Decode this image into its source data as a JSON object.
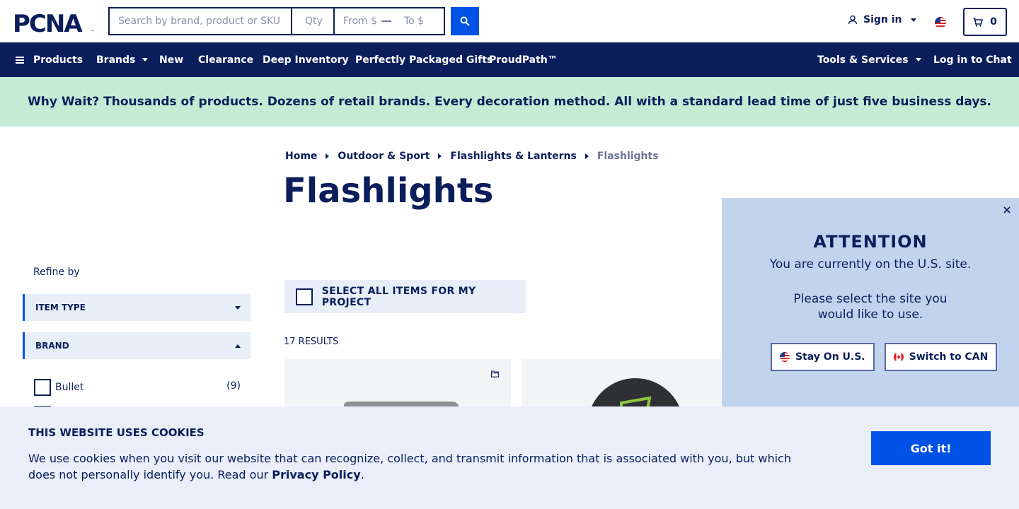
{
  "header": {
    "logo_text": "PCNA",
    "search": {
      "placeholder": "Search by brand, product or SKU",
      "value": ""
    },
    "qty": {
      "placeholder": "Qty",
      "value": ""
    },
    "price_from": {
      "placeholder": "From $",
      "value": ""
    },
    "price_to": {
      "placeholder": "To $",
      "value": ""
    },
    "signin_label": "Sign in",
    "cart_count": "0"
  },
  "nav": {
    "products": "Products",
    "brands": "Brands",
    "new": "New",
    "clearance": "Clearance",
    "deep_inventory": "Deep Inventory",
    "gifts": "Perfectly Packaged Gifts",
    "proudpath": "ProudPath™",
    "tools": "Tools & Services",
    "chat": "Log in to Chat"
  },
  "promo": "Why Wait? Thousands of products. Dozens of retail brands. Every decoration method. All with a standard lead time of just five business days.",
  "breadcrumb": [
    "Home",
    "Outdoor & Sport",
    "Flashlights & Lanterns",
    "Flashlights"
  ],
  "page_title": "Flashlights",
  "sidebar": {
    "refine_label": "Refine by",
    "facets": [
      {
        "label": "ITEM TYPE",
        "expanded": false
      },
      {
        "label": "BRAND",
        "expanded": true
      }
    ],
    "brand_options": [
      {
        "label": "Bullet",
        "count": "(9)"
      }
    ]
  },
  "select_all_label": "SELECT ALL ITEMS FOR MY PROJECT",
  "results_label": "17 RESULTS",
  "attention": {
    "title": "ATTENTION",
    "line1": "You are currently on the U.S. site.",
    "line2": "Please select the site you would like to use.",
    "stay_label": "Stay On U.S.",
    "switch_label": "Switch to CAN"
  },
  "cookie": {
    "title": "THIS WEBSITE USES COOKIES",
    "text": "We use cookies when you visit our website that can recognize, collect, and transmit information that is associated with you, but which does not personally identify you. Read our ",
    "link": "Privacy Policy",
    "period": ".",
    "button": "Got it!"
  },
  "colors": {
    "navy": "#0a1e5c",
    "accent_blue": "#0052e6",
    "promo_green": "#c4ecd5",
    "modal_blue": "#c2d3ee",
    "cookie_bg": "#e9eef9"
  }
}
